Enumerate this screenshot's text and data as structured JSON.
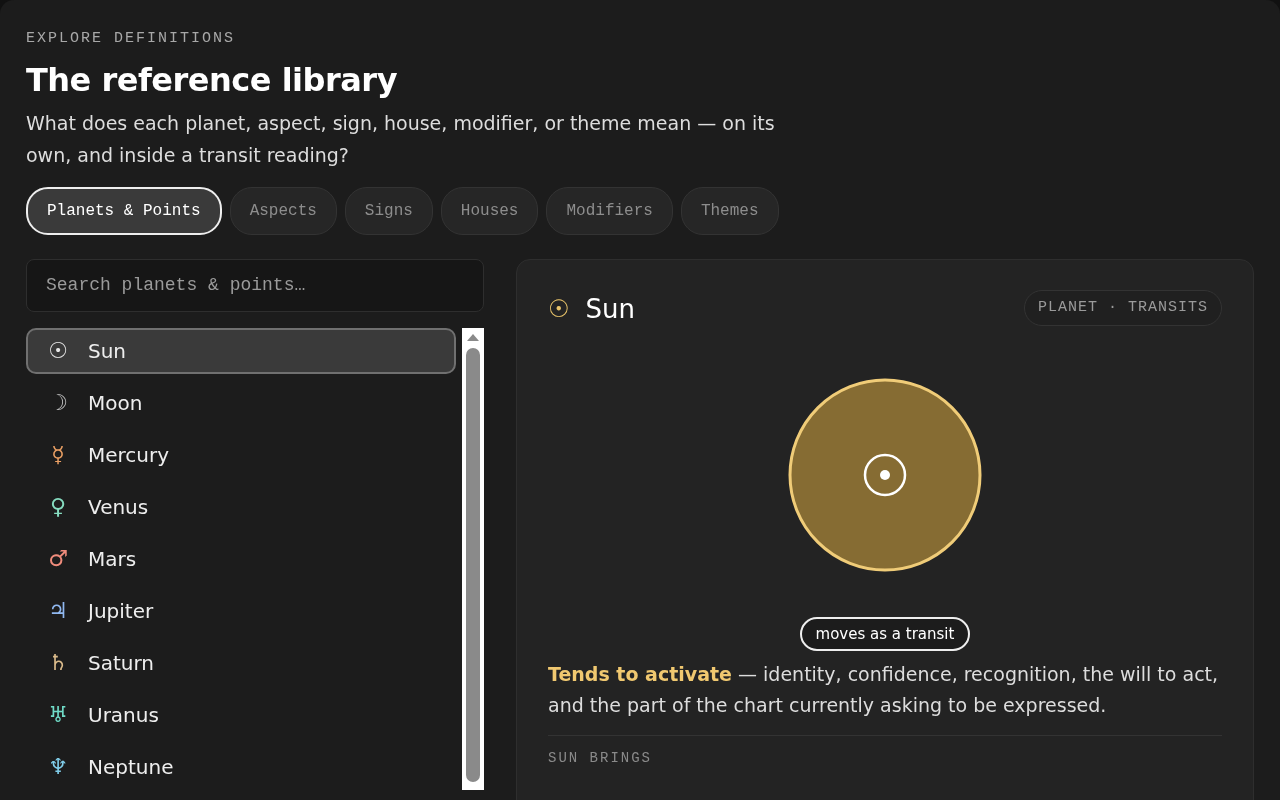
{
  "eyebrow": "EXPLORE DEFINITIONS",
  "title": "The reference library",
  "subtitle": "What does each planet, aspect, sign, house, modifier, or theme mean — on its own, and inside a transit reading?",
  "tabs": [
    {
      "label": "Planets & Points",
      "selected": true
    },
    {
      "label": "Aspects",
      "selected": false
    },
    {
      "label": "Signs",
      "selected": false
    },
    {
      "label": "Houses",
      "selected": false
    },
    {
      "label": "Modifiers",
      "selected": false
    },
    {
      "label": "Themes",
      "selected": false
    }
  ],
  "search": {
    "placeholder": "Search planets & points…"
  },
  "items": [
    {
      "glyph": "☉",
      "name": "Sun",
      "color": "#e8e8e8",
      "selected": true
    },
    {
      "glyph": "☽",
      "name": "Moon",
      "color": "#bdbdbd",
      "selected": false
    },
    {
      "glyph": "☿",
      "name": "Mercury",
      "color": "#eba064",
      "selected": false
    },
    {
      "glyph": "♀",
      "name": "Venus",
      "color": "#86dcc0",
      "selected": false
    },
    {
      "glyph": "♂",
      "name": "Mars",
      "color": "#f08c7c",
      "selected": false
    },
    {
      "glyph": "♃",
      "name": "Jupiter",
      "color": "#90b8f0",
      "selected": false
    },
    {
      "glyph": "♄",
      "name": "Saturn",
      "color": "#dcbc8c",
      "selected": false
    },
    {
      "glyph": "♅",
      "name": "Uranus",
      "color": "#70dcc8",
      "selected": false
    },
    {
      "glyph": "♆",
      "name": "Neptune",
      "color": "#80cce8",
      "selected": false
    }
  ],
  "detail": {
    "glyph": "☉",
    "name": "Sun",
    "tag": "PLANET · TRANSITS",
    "pill": "moves as a transit",
    "description": "**Tends to activate** — identity, confidence, recognition, the will to act, and the part of the chart currently asking to be expressed.",
    "section_label": "SUN BRINGS"
  }
}
